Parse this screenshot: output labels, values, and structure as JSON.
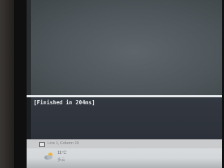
{
  "output_panel": {
    "text": "[Finished in 204ms]"
  },
  "status_bar": {
    "position": "Line 1, Column 20"
  },
  "taskbar": {
    "weather": {
      "temperature": "11°C",
      "condition": "多云",
      "icon": "cloud-sun-icon"
    }
  },
  "colors": {
    "editor_bg": "#51595e",
    "output_bg": "#2f343c",
    "divider": "#e8ecee",
    "status_bar_bg": "#c9cbcc",
    "taskbar_bg": "#d4d7d9"
  }
}
